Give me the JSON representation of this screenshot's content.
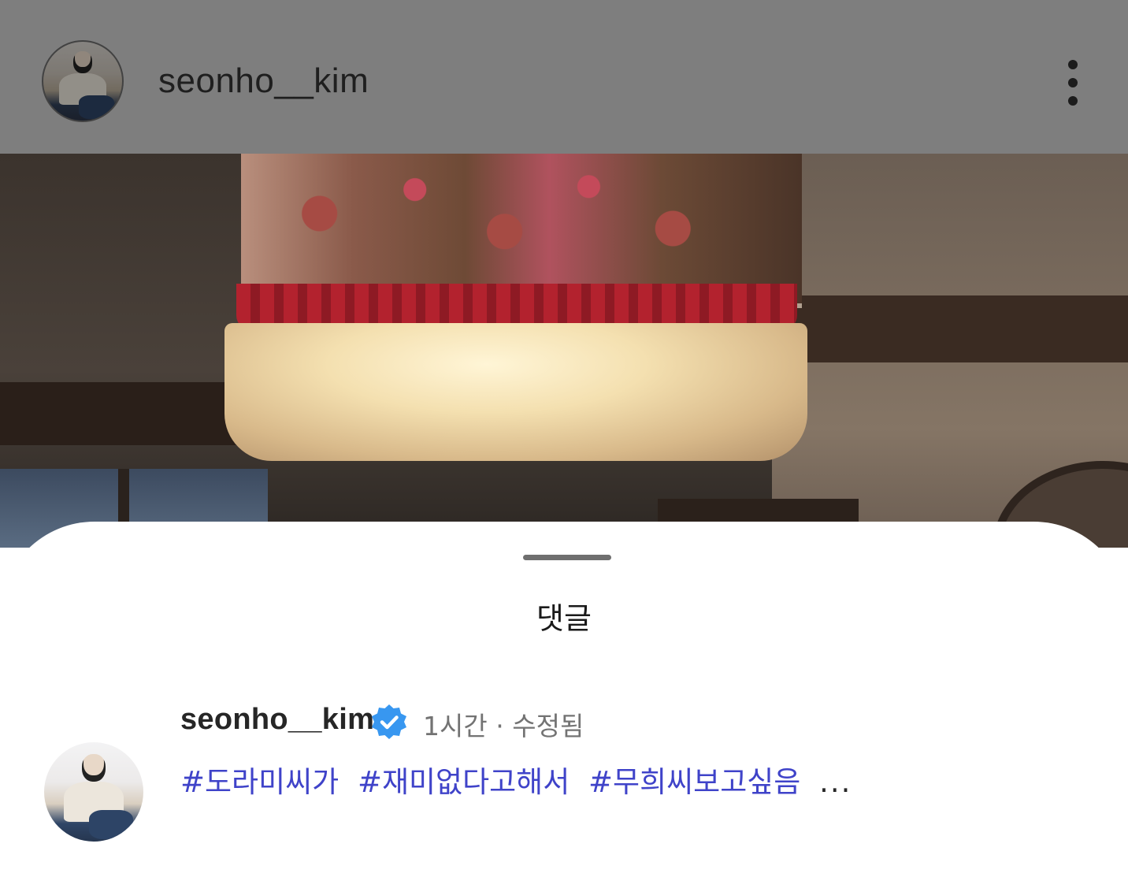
{
  "header": {
    "username": "seonho__kim",
    "menu_icon": "kebab-menu-icon"
  },
  "sheet": {
    "title": "댓글"
  },
  "comment": {
    "username": "seonho__kim",
    "verified_icon": "verified-badge-icon",
    "verified_color": "#3897f0",
    "time": "1시간",
    "separator": "·",
    "edited": "수정됨",
    "hashtags": [
      "#도라미씨가",
      "#재미없다고해서",
      "#무희씨보고싶음"
    ],
    "more": "...",
    "hashtag_color": "#3f43c9"
  }
}
